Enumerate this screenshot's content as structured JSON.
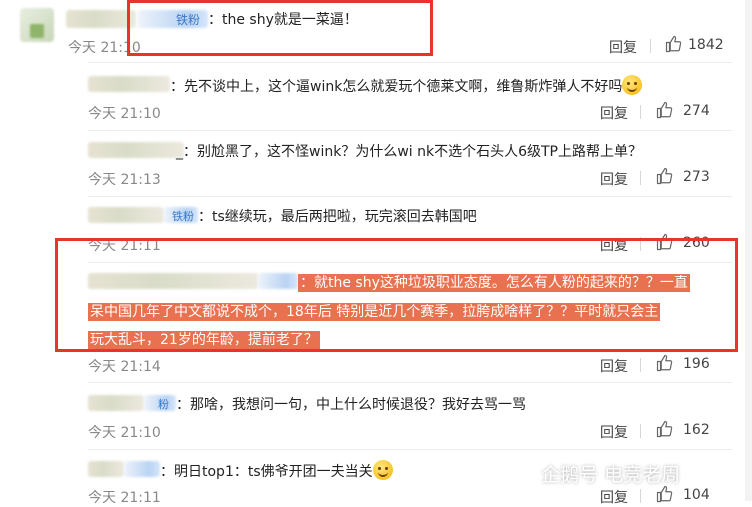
{
  "top_comment": {
    "badge": "铁粉",
    "text": "：the shy就是一菜逼！",
    "time": "今天 21:10",
    "reply_label": "回复",
    "likes": "1842"
  },
  "replies": [
    {
      "text": "：先不谈中上，这个逼wink怎么就爱玩个德莱文啊，维鲁斯炸弹人不好吗",
      "time": "今天 21:10",
      "reply_label": "回复",
      "likes": "274"
    },
    {
      "text": "_：别尬黑了，这不怪wink？为什么wi nk不选个石头人6级TP上路帮上单？",
      "time": "今天 21:13",
      "reply_label": "回复",
      "likes": "273"
    },
    {
      "badge": "铁粉",
      "text": "：ts继续玩，最后两把啦，玩完滚回去韩国吧",
      "time": "今天 21:11",
      "reply_label": "回复",
      "likes": "260"
    },
    {
      "text_line1": "：就the shy这种垃圾职业态度。怎么有人粉的起来的？？一直",
      "text_line2": "呆中国几年了中文都说不成个，18年后 特别是近几个赛季，拉胯成啥样了？？平时就只会主",
      "text_line3": "玩大乱斗，21岁的年龄，提前老了？",
      "time": "今天 21:14",
      "reply_label": "回复",
      "likes": "196"
    },
    {
      "badge": "粉",
      "text": "：那啥，我想问一句，中上什么时候退役？我好去骂一骂",
      "time": "今天 21:10",
      "reply_label": "回复",
      "likes": "162"
    },
    {
      "text": "：明日top1：ts佛爷开团一夫当关",
      "time": "今天 21:11",
      "reply_label": "回复",
      "likes": "104"
    }
  ],
  "watermark": "企鹅号 电竞老周",
  "colors": {
    "highlight": "#e8714f",
    "annotation_box": "#e8352c"
  }
}
